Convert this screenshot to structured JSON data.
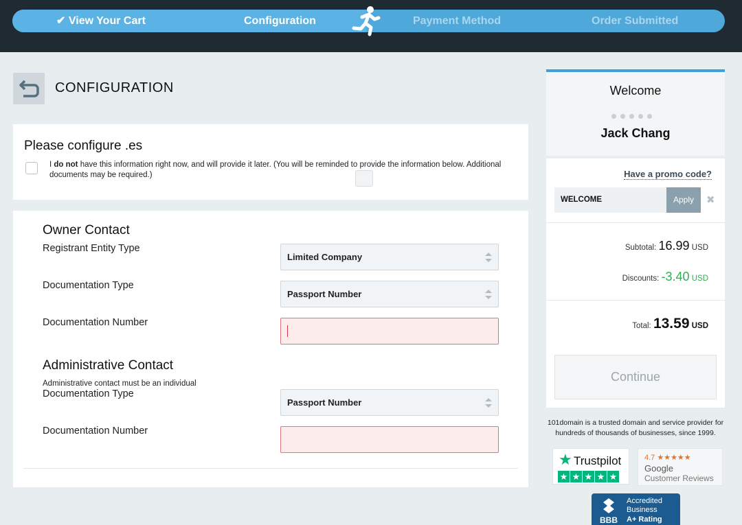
{
  "progress": {
    "steps": [
      {
        "label": "View Your Cart",
        "state": "done"
      },
      {
        "label": "Configuration",
        "state": "current"
      },
      {
        "label": "Payment Method",
        "state": "upcoming"
      },
      {
        "label": "Order Submitted",
        "state": "upcoming"
      }
    ],
    "check_icon": "✔"
  },
  "header": {
    "title": "CONFIGURATION"
  },
  "configure_panel": {
    "heading": "Please configure .es",
    "checkbox_prefix": "I ",
    "checkbox_bold": "do not",
    "checkbox_text": " have this information right now, and will provide it later. (You will be reminded to provide the information below. Additional documents may be required.)",
    "checked": false
  },
  "owner_contact": {
    "title": "Owner Contact",
    "fields": [
      {
        "label": "Registrant Entity Type",
        "value": "Limited Company"
      },
      {
        "label": "Documentation Type",
        "value": "Passport Number"
      },
      {
        "label": "Documentation Number",
        "value": ""
      }
    ]
  },
  "admin_contact": {
    "title": "Administrative Contact",
    "note": "Administrative contact must be an individual",
    "fields": [
      {
        "label": "Documentation Type",
        "value": "Passport Number"
      },
      {
        "label": "Documentation Number",
        "value": ""
      }
    ]
  },
  "welcome": {
    "title": "Welcome",
    "user_name": "Jack Chang"
  },
  "summary": {
    "promo_link": "Have a promo code?",
    "promo_value": "WELCOME",
    "apply_label": "Apply",
    "subtotal_label": "Subtotal:",
    "subtotal_value": "16.99",
    "discount_label": "Discounts:",
    "discount_value": "-3.40",
    "total_label": "Total:",
    "total_value": "13.59",
    "currency": "USD",
    "continue_label": "Continue"
  },
  "trust": {
    "text": "101domain is a trusted domain and service provider for hundreds of thousands of businesses, since 1999.",
    "trustpilot_name": "Trustpilot",
    "google_rating": "4.7 ★★★★★",
    "google_name": "Google",
    "google_reviews": "Customer Reviews",
    "bbb_line1": "Accredited",
    "bbb_line2": "Business",
    "bbb_line3": "A+ Rating",
    "bbb_logo_text": "BBB"
  },
  "colors": {
    "accent": "#3ea1d8",
    "error_bg": "#fdecec",
    "discount_green": "#2fae57",
    "trustpilot_green": "#00b67a"
  }
}
